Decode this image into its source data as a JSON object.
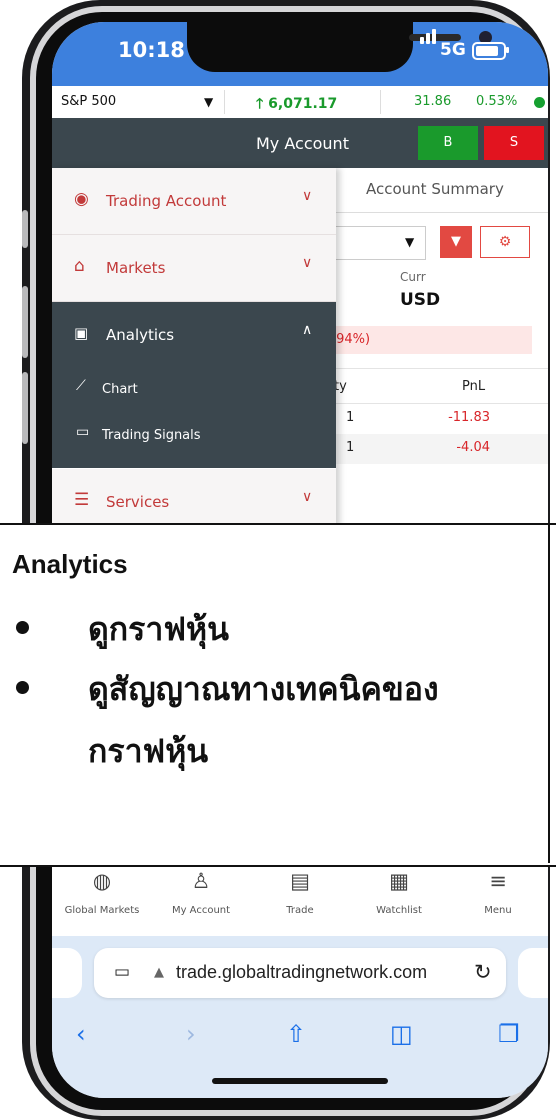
{
  "status_bar": {
    "time": "10:18",
    "network": "5G"
  },
  "ticker": {
    "symbol": "S&P 500",
    "price": "6,071.17",
    "change": "31.86",
    "change_pct": "0.53%",
    "up_arrow": "🡑"
  },
  "header": {
    "title": "My Account",
    "buy_label": "B",
    "sell_label": "S"
  },
  "content": {
    "summary_tab": "Account Summary",
    "currency_label": "Curr",
    "currency_value": "USD",
    "pct_text": ".94%)",
    "columns": {
      "qty": "ty",
      "pnl": "PnL"
    },
    "rows": [
      {
        "qty": "1",
        "pnl": "-11.83"
      },
      {
        "qty": "1",
        "pnl": "-4.04"
      }
    ]
  },
  "menu": {
    "items": [
      {
        "label": "Trading Account",
        "icon": "user-circle-icon"
      },
      {
        "label": "Markets",
        "icon": "bank-icon"
      },
      {
        "label": "Analytics",
        "icon": "analytics-icon"
      },
      {
        "label": "Services",
        "icon": "hand-coins-icon"
      }
    ],
    "analytics_sub": [
      {
        "label": "Chart",
        "icon": "line-chart-icon"
      },
      {
        "label": "Trading Signals",
        "icon": "book-icon"
      }
    ]
  },
  "tab_bar": [
    {
      "label": "Global Markets",
      "icon": "globe-icon"
    },
    {
      "label": "My Account",
      "icon": "user-icon"
    },
    {
      "label": "Trade",
      "icon": "wallet-icon"
    },
    {
      "label": "Watchlist",
      "icon": "calculator-icon"
    },
    {
      "label": "Menu",
      "icon": "menu-icon"
    }
  ],
  "browser": {
    "url": "trade.globaltradingnetwork.com"
  },
  "overlay": {
    "title": "Analytics",
    "bullets": [
      "ดูกราฟหุ้น",
      "ดูสัญญาณทางเทคนิคของ",
      "กราฟหุ้น"
    ]
  },
  "colors": {
    "accent_red": "#c23a3a",
    "header": "#3b474e",
    "buy": "#1a9a2c",
    "sell": "#e2141f",
    "status_bar": "#3d80dd"
  }
}
